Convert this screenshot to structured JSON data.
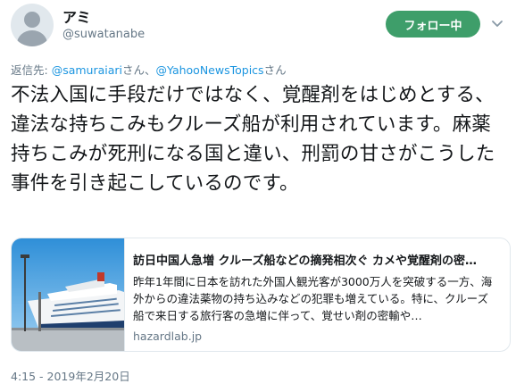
{
  "user": {
    "display_name": "アミ",
    "handle": "@suwatanabe"
  },
  "follow_button": {
    "label": "フォロー中"
  },
  "reply": {
    "prefix": "返信先: ",
    "mention1": "@samuraiari",
    "sep": "さん、",
    "mention2": "@YahooNewsTopics",
    "suffix": "さん"
  },
  "tweet": {
    "text": "不法入国に手段だけではなく、覚醒剤をはじめとする、違法な持ちこみもクルーズ船が利用されています。麻薬持ちこみが死刑になる国と違い、刑罰の甘さがこうした事件を引き起こしているのです。"
  },
  "card": {
    "title": "訪日中国人急増 クルーズ船などの摘発相次ぐ カメや覚醒剤の密…",
    "description": "昨年1年間に日本を訪れた外国人観光客が3000万人を突破する一方、海外からの違法薬物の持ち込みなどの犯罪も増えている。特に、クルーズ船で来日する旅行客の急増に伴って、覚せい剤の密輸や…",
    "domain": "hazardlab.jp",
    "thumbnail": "cruise-ship-at-port-photo"
  },
  "timestamp": "4:15 - 2019年2月20日",
  "colors": {
    "follow_green": "#3e9e6a",
    "link_blue": "#1b95e0",
    "secondary_gray": "#657786"
  }
}
